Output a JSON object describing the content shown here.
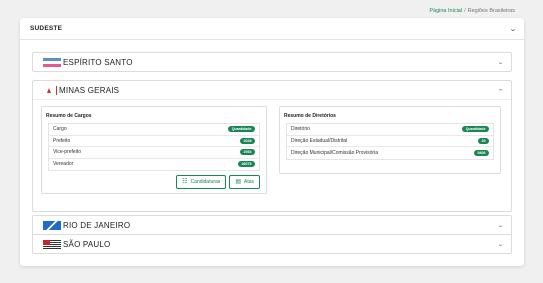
{
  "breadcrumb": {
    "home": "Página Inicial",
    "separator": "/",
    "current": "Regiões Brasileiras"
  },
  "region": {
    "title": "SUDESTE"
  },
  "states": {
    "es": {
      "name": "ESPÍRITO SANTO"
    },
    "mg": {
      "name": "MINAS GERAIS"
    },
    "rj": {
      "name": "RIO DE JANEIRO"
    },
    "sp": {
      "name": "SÃO PAULO"
    }
  },
  "cargos": {
    "title": "Resumo de Cargos",
    "header": {
      "label": "Cargo",
      "badge": "Quantidade"
    },
    "rows": [
      {
        "label": "Prefeito",
        "value": "2028"
      },
      {
        "label": "Vice-prefeito",
        "value": "2054"
      },
      {
        "label": "Vereador",
        "value": "46079"
      }
    ],
    "buttons": {
      "candidaturas": "Candidaturas",
      "atas": "Atas"
    }
  },
  "diretorios": {
    "title": "Resumo de Diretórios",
    "header": {
      "label": "Diretório",
      "badge": "Quantidade"
    },
    "rows": [
      {
        "label": "Direção Estadual/Distrital",
        "value": "29"
      },
      {
        "label": "Direção Municipal/Comissão Provisória",
        "value": "9406"
      }
    ]
  },
  "icons": {
    "candidaturas": "people-icon",
    "atas": "document-icon",
    "chevron": "chevron-down-icon"
  },
  "colors": {
    "accent": "#198754",
    "background": "#f0f0f0"
  }
}
